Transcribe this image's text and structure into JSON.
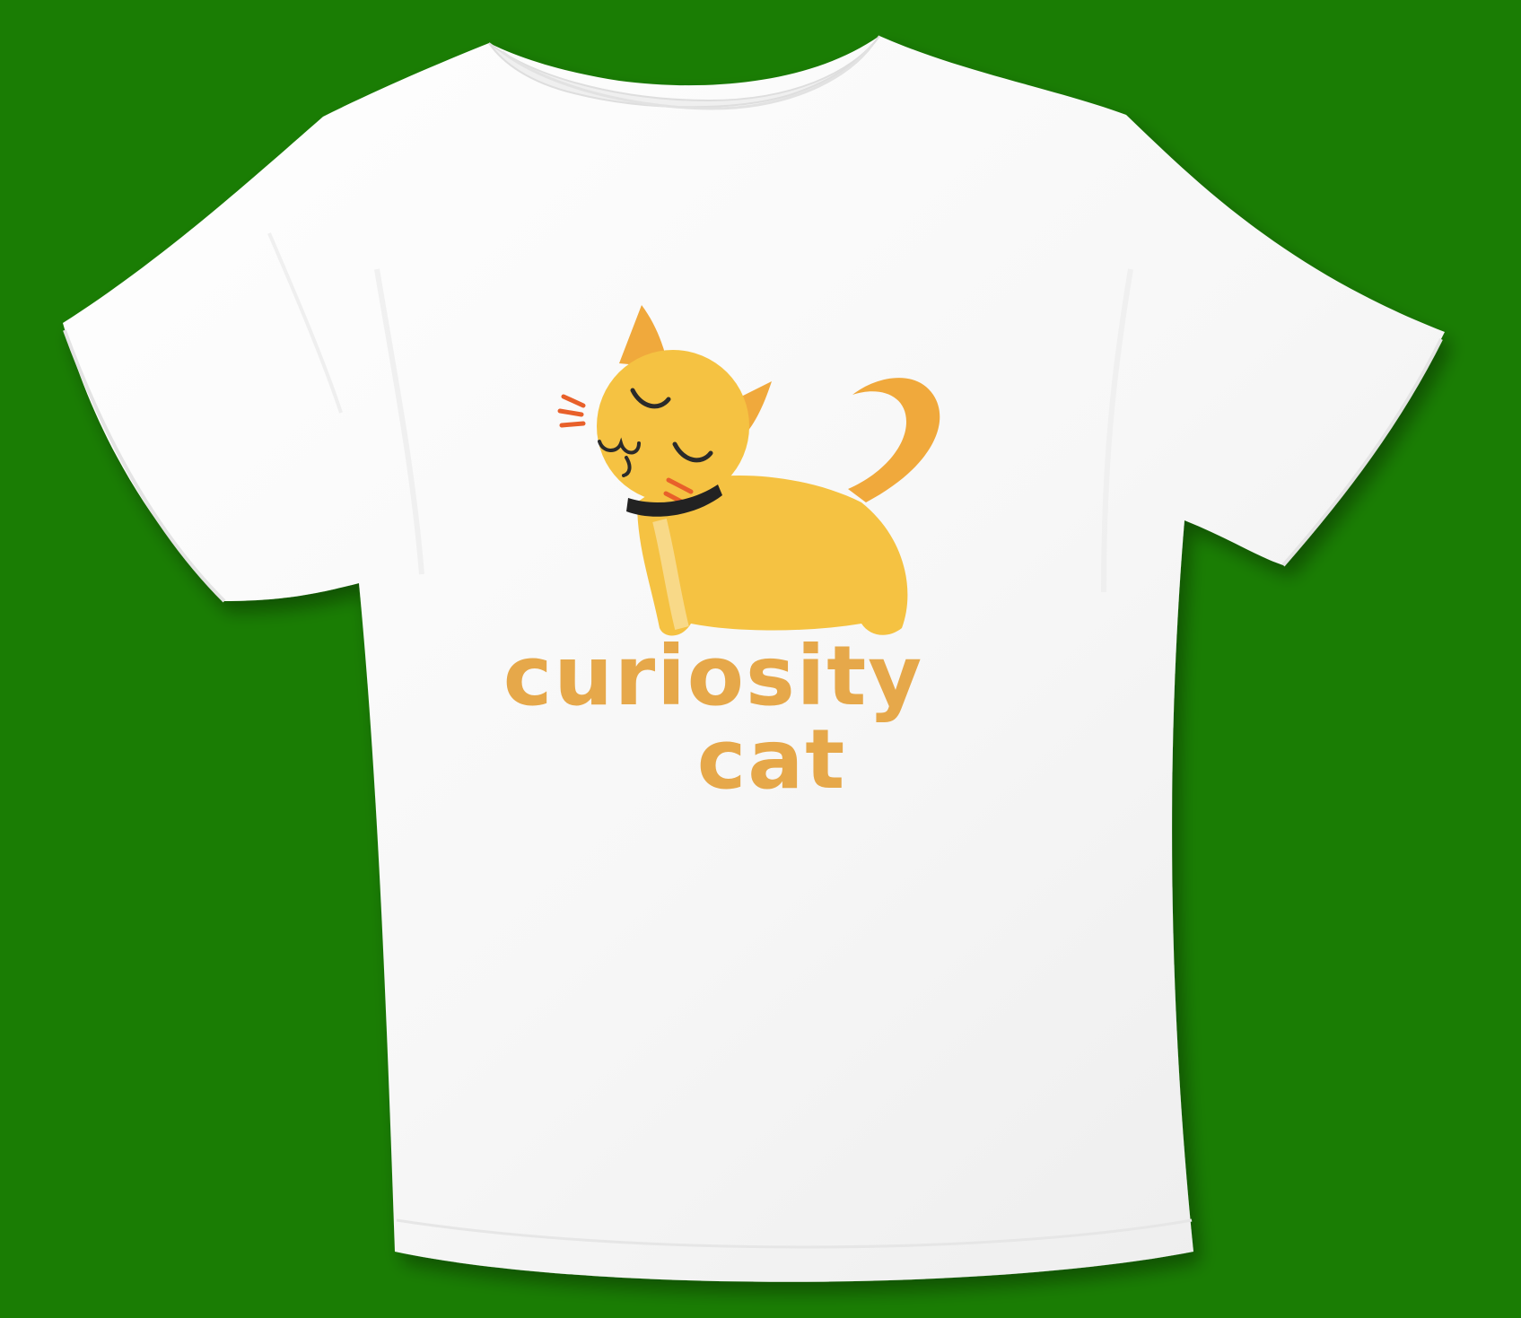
{
  "scene": {
    "background_color": "#1a7d04",
    "garment": "white-tshirt",
    "garment_color": "#fbfbfb"
  },
  "print": {
    "line1": "curiosity",
    "line2": "cat",
    "text_color": "#e6a84a",
    "cat_body_color": "#f5c242",
    "cat_ear_tail_color": "#f0a93c",
    "collar_color": "#222222",
    "whisker_color": "#e8602a"
  }
}
